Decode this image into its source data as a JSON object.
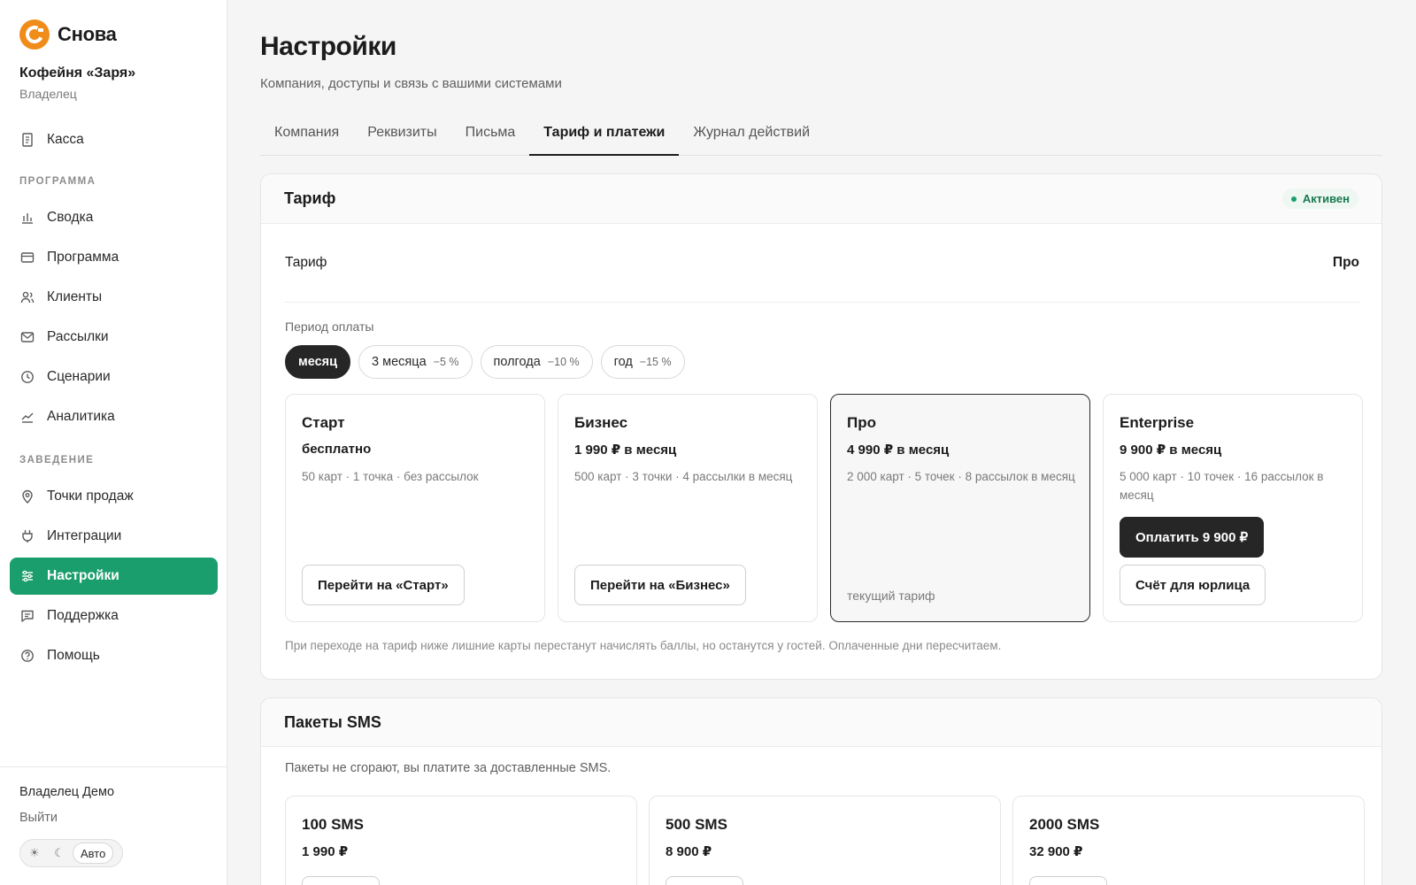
{
  "brand": {
    "name": "Снова",
    "color": "#f08c1a"
  },
  "org": {
    "name": "Кофейня «Заря»",
    "role": "Владелец"
  },
  "nav": {
    "top": [
      {
        "label": "Касса",
        "icon": "receipt-icon"
      }
    ],
    "sections": [
      {
        "title": "ПРОГРАММА",
        "items": [
          {
            "label": "Сводка",
            "icon": "bar-chart-icon"
          },
          {
            "label": "Программа",
            "icon": "card-icon"
          },
          {
            "label": "Клиенты",
            "icon": "users-icon"
          },
          {
            "label": "Рассылки",
            "icon": "mail-icon"
          },
          {
            "label": "Сценарии",
            "icon": "clock-icon"
          },
          {
            "label": "Аналитика",
            "icon": "trend-icon"
          }
        ]
      },
      {
        "title": "ЗАВЕДЕНИЕ",
        "items": [
          {
            "label": "Точки продаж",
            "icon": "pin-icon"
          },
          {
            "label": "Интеграции",
            "icon": "plug-icon"
          },
          {
            "label": "Настройки",
            "icon": "sliders-icon",
            "active": true
          },
          {
            "label": "Поддержка",
            "icon": "chat-icon"
          },
          {
            "label": "Помощь",
            "icon": "help-icon"
          }
        ]
      }
    ],
    "active_color": "#1a9e6e"
  },
  "footer": {
    "user": "Владелец Демо",
    "logout": "Выйти",
    "theme": {
      "light": "☀",
      "dark": "☾",
      "auto": "Авто"
    }
  },
  "page": {
    "title": "Настройки",
    "subtitle": "Компания, доступы и связь с вашими системами"
  },
  "tabs": [
    {
      "label": "Компания"
    },
    {
      "label": "Реквизиты"
    },
    {
      "label": "Письма"
    },
    {
      "label": "Тариф и платежи",
      "active": true
    },
    {
      "label": "Журнал действий"
    }
  ],
  "tariff": {
    "title": "Тариф",
    "status": "Активен",
    "row_label": "Тариф",
    "row_value": "Про",
    "period_label": "Период оплаты",
    "periods": [
      {
        "label": "месяц",
        "discount": "",
        "selected": true
      },
      {
        "label": "3 месяца",
        "discount": "−5 %"
      },
      {
        "label": "полгода",
        "discount": "−10 %"
      },
      {
        "label": "год",
        "discount": "−15 %"
      }
    ],
    "plans": [
      {
        "name": "Старт",
        "price": "бесплатно",
        "desc": "50 карт · 1 точка · без рассылок",
        "button": "Перейти на «Старт»"
      },
      {
        "name": "Бизнес",
        "price": "1 990 ₽ в месяц",
        "desc": "500 карт · 3 точки · 4 рассылки в месяц",
        "button": "Перейти на «Бизнес»"
      },
      {
        "name": "Про",
        "price": "4 990 ₽ в месяц",
        "desc": "2 000 карт · 5 точек · 8 рассылок в месяц",
        "current_label": "текущий тариф"
      },
      {
        "name": "Enterprise",
        "price": "9 900 ₽ в месяц",
        "desc": "5 000 карт · 10 точек · 16 рассылок в месяц",
        "pay_button": "Оплатить 9 900 ₽",
        "invoice_button": "Счёт для юрлица"
      }
    ],
    "note": "При переходе на тариф ниже лишние карты перестанут начислять баллы, но останутся у гостей. Оплаченные дни пересчитаем."
  },
  "sms": {
    "title": "Пакеты SMS",
    "desc": "Пакеты не сгорают, вы платите за доставленные SMS.",
    "packs": [
      {
        "name": "100 SMS",
        "price": "1 990 ₽"
      },
      {
        "name": "500 SMS",
        "price": "8 900 ₽"
      },
      {
        "name": "2000 SMS",
        "price": "32 900 ₽"
      }
    ]
  }
}
